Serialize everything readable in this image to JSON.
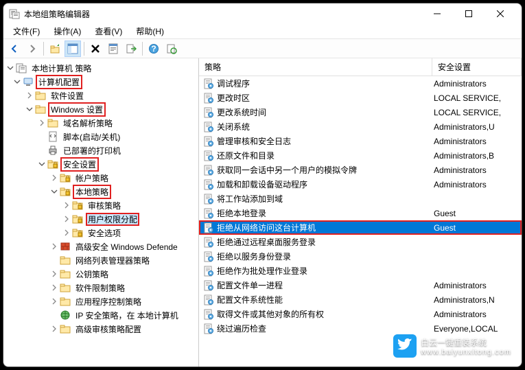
{
  "window": {
    "title": "本地组策略编辑器"
  },
  "menu": {
    "file": "文件(F)",
    "action": "操作(A)",
    "view": "查看(V)",
    "help": "帮助(H)"
  },
  "list": {
    "header_policy": "策略",
    "header_setting": "安全设置",
    "rows": [
      {
        "name": "调试程序",
        "setting": "Administrators"
      },
      {
        "name": "更改时区",
        "setting": "LOCAL SERVICE,"
      },
      {
        "name": "更改系统时间",
        "setting": "LOCAL SERVICE,"
      },
      {
        "name": "关闭系统",
        "setting": "Administrators,U"
      },
      {
        "name": "管理审核和安全日志",
        "setting": "Administrators"
      },
      {
        "name": "还原文件和目录",
        "setting": "Administrators,B"
      },
      {
        "name": "获取同一会话中另一个用户的模拟令牌",
        "setting": "Administrators"
      },
      {
        "name": "加载和卸载设备驱动程序",
        "setting": "Administrators"
      },
      {
        "name": "将工作站添加到域",
        "setting": ""
      },
      {
        "name": "拒绝本地登录",
        "setting": "Guest"
      },
      {
        "name": "拒绝从网络访问这台计算机",
        "setting": "Guest",
        "selected": true,
        "red": true
      },
      {
        "name": "拒绝通过远程桌面服务登录",
        "setting": ""
      },
      {
        "name": "拒绝以服务身份登录",
        "setting": ""
      },
      {
        "name": "拒绝作为批处理作业登录",
        "setting": ""
      },
      {
        "name": "配置文件单一进程",
        "setting": "Administrators"
      },
      {
        "name": "配置文件系统性能",
        "setting": "Administrators,N"
      },
      {
        "name": "取得文件或其他对象的所有权",
        "setting": "Administrators"
      },
      {
        "name": "绕过遍历检查",
        "setting": "Everyone,LOCAL"
      }
    ]
  },
  "tree": [
    {
      "label": "本地计算机 策略",
      "indent": 0,
      "exp": "open",
      "icon": "doc"
    },
    {
      "label": "计算机配置",
      "indent": 1,
      "exp": "open",
      "icon": "computer",
      "red": true
    },
    {
      "label": "软件设置",
      "indent": 2,
      "exp": "closed",
      "icon": "folder"
    },
    {
      "label": "Windows 设置",
      "indent": 2,
      "exp": "open",
      "icon": "folder",
      "red": true
    },
    {
      "label": "域名解析策略",
      "indent": 3,
      "exp": "closed",
      "icon": "folder"
    },
    {
      "label": "脚本(启动/关机)",
      "indent": 3,
      "exp": "none",
      "icon": "script"
    },
    {
      "label": "已部署的打印机",
      "indent": 3,
      "exp": "none",
      "icon": "printer"
    },
    {
      "label": "安全设置",
      "indent": 3,
      "exp": "open",
      "icon": "lockfolder",
      "red": true
    },
    {
      "label": "帐户策略",
      "indent": 4,
      "exp": "closed",
      "icon": "lockfolder"
    },
    {
      "label": "本地策略",
      "indent": 4,
      "exp": "open",
      "icon": "lockfolder",
      "red": true
    },
    {
      "label": "审核策略",
      "indent": 5,
      "exp": "closed",
      "icon": "lockfolder"
    },
    {
      "label": "用户权限分配",
      "indent": 5,
      "exp": "closed",
      "icon": "lockfolder",
      "red": true,
      "selected": true
    },
    {
      "label": "安全选项",
      "indent": 5,
      "exp": "closed",
      "icon": "lockfolder"
    },
    {
      "label": "高级安全 Windows Defende",
      "indent": 4,
      "exp": "closed",
      "icon": "firewall"
    },
    {
      "label": "网络列表管理器策略",
      "indent": 4,
      "exp": "none",
      "icon": "folder"
    },
    {
      "label": "公钥策略",
      "indent": 4,
      "exp": "closed",
      "icon": "folder"
    },
    {
      "label": "软件限制策略",
      "indent": 4,
      "exp": "closed",
      "icon": "folder"
    },
    {
      "label": "应用程序控制策略",
      "indent": 4,
      "exp": "closed",
      "icon": "folder"
    },
    {
      "label": "IP 安全策略，在 本地计算机",
      "indent": 4,
      "exp": "none",
      "icon": "ip"
    },
    {
      "label": "高级审核策略配置",
      "indent": 4,
      "exp": "closed",
      "icon": "folder"
    }
  ],
  "watermark": {
    "line1": "白云一键重装系统",
    "line2": "www.baiyunxitong.com"
  }
}
